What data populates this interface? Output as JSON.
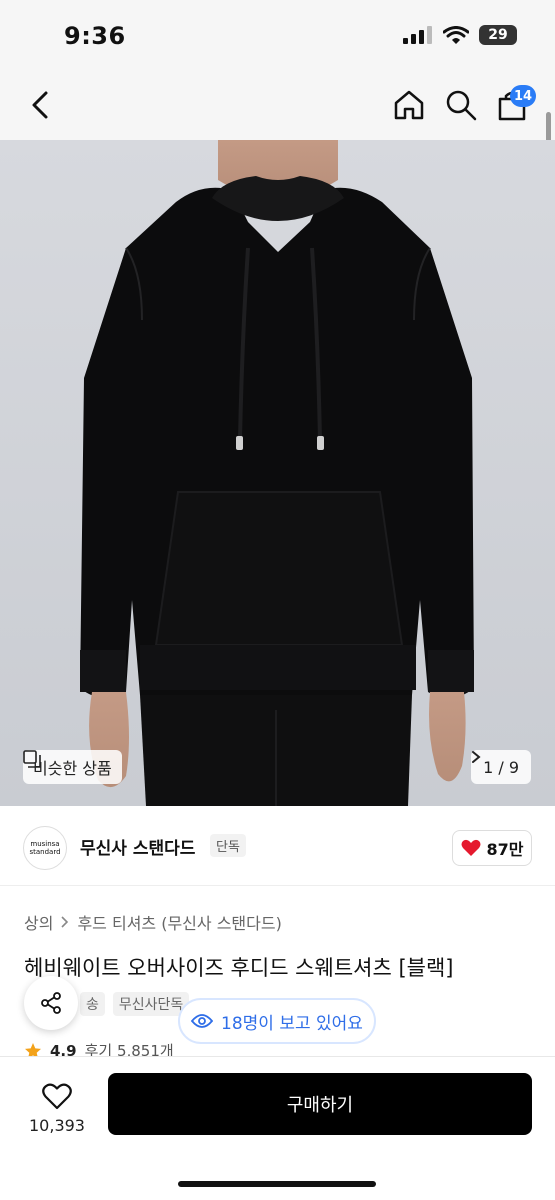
{
  "status_bar": {
    "time": "9:36",
    "battery": "29"
  },
  "nav": {
    "cart_count": "14"
  },
  "gallery": {
    "similar_label": "비슷한 상품",
    "page_indicator": "1 / 9"
  },
  "brand": {
    "logo_top": "musinsa",
    "logo_bottom": "standard",
    "name": "무신사 스탠다드",
    "tag": "단독",
    "likes": "87만"
  },
  "breadcrumb": {
    "level1": "상의",
    "level2": "후드 티셔츠 (무신사 스탠다드)"
  },
  "product": {
    "title": "헤비웨이트 오버사이즈 후디드 스웨트셔츠 [블랙]",
    "tags": [
      "송",
      "무신사단독"
    ],
    "viewers": "18명이 보고 있어요",
    "rating": "4.9",
    "reviews": "후기 5,851개"
  },
  "bottom": {
    "favorite_count": "10,393",
    "buy_label": "구매하기"
  },
  "colors": {
    "accent_blue": "#2a7cf6",
    "heart_red": "#e5192e",
    "star_orange": "#f3a21a"
  }
}
